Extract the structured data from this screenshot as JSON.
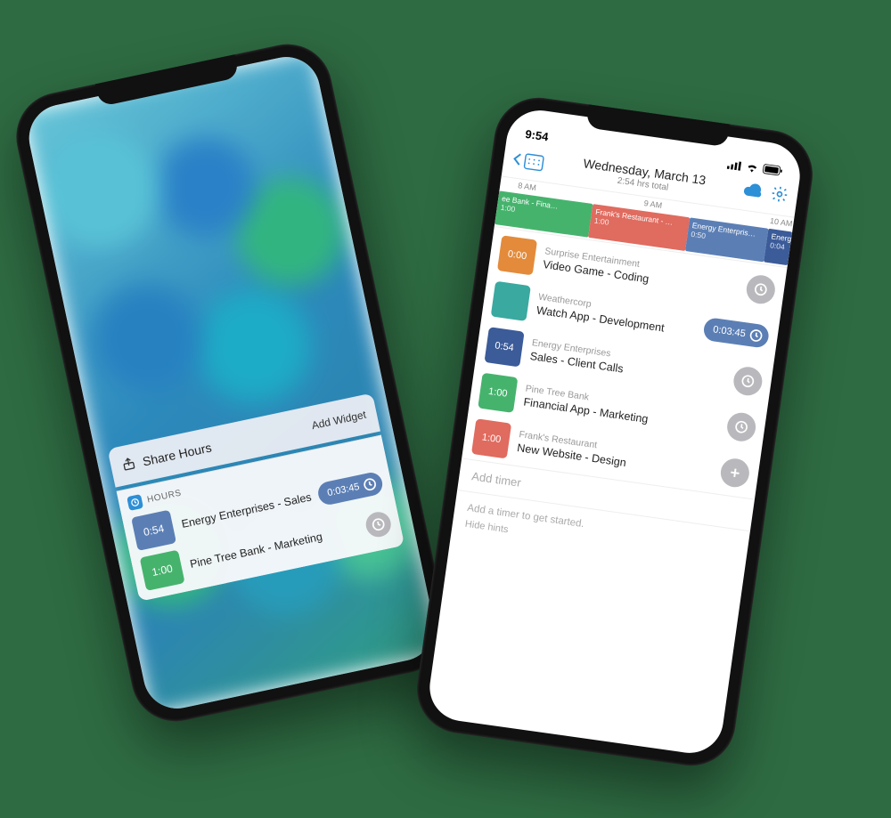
{
  "colors": {
    "blue": "#5b7fb5",
    "green": "#46b36d",
    "teal": "#3aa9a0",
    "orange": "#e38b3a",
    "navy": "#3b5b99",
    "coral": "#e06b5f",
    "grey": "#b9b9bd",
    "accent": "#2d8fd6"
  },
  "left_phone": {
    "share_title": "Share Hours",
    "add_widget": "Add Widget",
    "widget_name": "HOURS",
    "rows": [
      {
        "time": "0:54",
        "color_key": "blue",
        "label": "Energy Enterprises - Sales",
        "running_timer": "0:03:45"
      },
      {
        "time": "1:00",
        "color_key": "green",
        "label": "Pine Tree Bank - Marketing",
        "running_timer": null
      }
    ]
  },
  "right_phone": {
    "status_time": "9:54",
    "date_title": "Wednesday, March 13",
    "subtitle": "2:54 hrs total",
    "timeline": {
      "ticks": [
        "8 AM",
        "9 AM",
        "10 AM"
      ],
      "blocks": [
        {
          "label": "ee Bank - Fina…",
          "dur": "1:00",
          "color_key": "green",
          "left_pct": 0,
          "width_pct": 32
        },
        {
          "label": "Frank's Restaurant - …",
          "dur": "1:00",
          "color_key": "coral",
          "left_pct": 32,
          "width_pct": 33
        },
        {
          "label": "Energy Enterpris…",
          "dur": "0:50",
          "color_key": "blue",
          "left_pct": 65,
          "width_pct": 27
        },
        {
          "label": "Energ…",
          "dur": "0:04",
          "color_key": "navy",
          "left_pct": 92,
          "width_pct": 8
        }
      ]
    },
    "timers": [
      {
        "time": "0:00",
        "color_key": "orange",
        "client": "Surprise Entertainment",
        "project": "Video Game - Coding",
        "action": "clock"
      },
      {
        "time": "",
        "color_key": "teal",
        "client": "Weathercorp",
        "project": "Watch App - Development",
        "action": "running",
        "running_timer": "0:03:45"
      },
      {
        "time": "0:54",
        "color_key": "navy",
        "client": "Energy Enterprises",
        "project": "Sales - Client Calls",
        "action": "clock"
      },
      {
        "time": "1:00",
        "color_key": "green",
        "client": "Pine Tree Bank",
        "project": "Financial App - Marketing",
        "action": "clock"
      },
      {
        "time": "1:00",
        "color_key": "coral",
        "client": "Frank's Restaurant",
        "project": "New Website - Design",
        "action": "plus"
      }
    ],
    "add_timer_placeholder": "Add timer",
    "hint": "Add a timer to get started.",
    "hide_hints": "Hide hints"
  }
}
